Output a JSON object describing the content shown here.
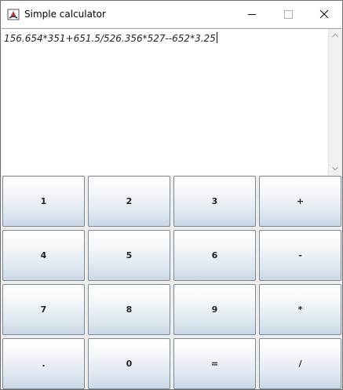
{
  "window": {
    "title": "Simple calculator",
    "controls": {
      "minimize_icon": "minimize-icon",
      "maximize_icon": "maximize-icon",
      "close_icon": "close-icon"
    }
  },
  "display": {
    "expression": "156.654*351+651.5/526.356*527--652*3.25"
  },
  "keypad": {
    "rows": [
      [
        "1",
        "2",
        "3",
        "+"
      ],
      [
        "4",
        "5",
        "6",
        "-"
      ],
      [
        "7",
        "8",
        "9",
        "*"
      ],
      [
        ".",
        "0",
        "=",
        "/"
      ]
    ]
  },
  "colors": {
    "titlebar_bg": "#ffffff",
    "key_border": "#7a8a99",
    "key_gradient_bottom": "#c9d7e5"
  }
}
